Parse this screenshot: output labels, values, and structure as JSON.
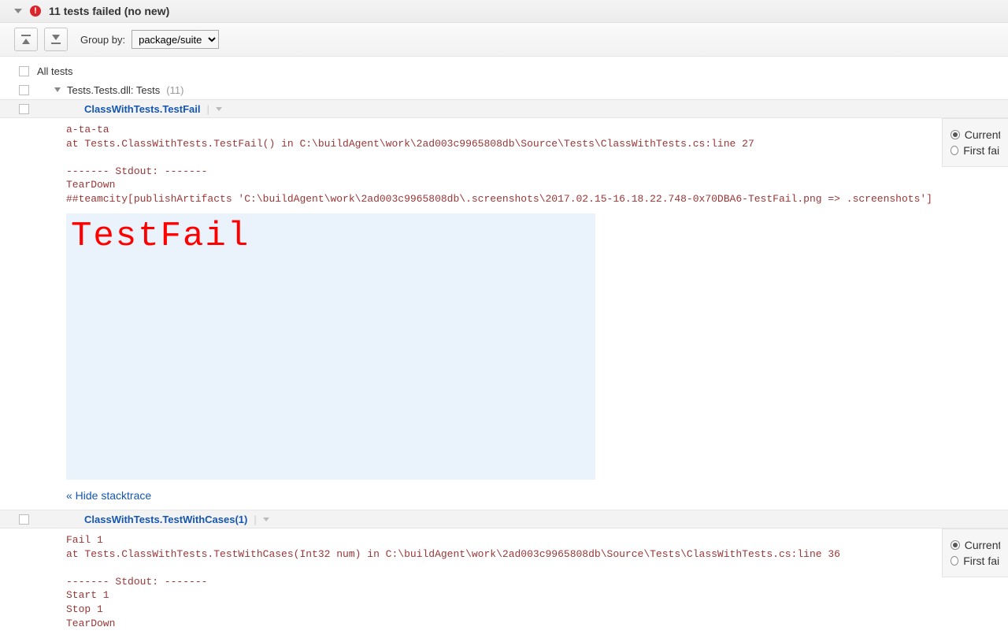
{
  "header": {
    "title": "11 tests failed (no new)"
  },
  "toolbar": {
    "group_by_label": "Group by:",
    "group_by_value": "package/suite"
  },
  "tree": {
    "all_tests_label": "All tests",
    "suite_label": "Tests.Tests.dll: Tests",
    "suite_count": "(11)"
  },
  "tests": [
    {
      "name": "ClassWithTests.TestFail",
      "stack": "a-ta-ta\nat Tests.ClassWithTests.TestFail() in C:\\buildAgent\\work\\2ad003c9965808db\\Source\\Tests\\ClassWithTests.cs:line 27\n\n------- Stdout: -------\nTearDown\n##teamcity[publishArtifacts 'C:\\buildAgent\\work\\2ad003c9965808db\\.screenshots\\2017.02.15-16.18.22.748-0x70DBA6-TestFail.png => .screenshots']",
      "screenshot_text": "TestFail",
      "hide_link": "« Hide stacktrace",
      "side": {
        "current": "Current",
        "first": "First failu"
      }
    },
    {
      "name": "ClassWithTests.TestWithCases(1)",
      "stack": "Fail 1\nat Tests.ClassWithTests.TestWithCases(Int32 num) in C:\\buildAgent\\work\\2ad003c9965808db\\Source\\Tests\\ClassWithTests.cs:line 36\n\n------- Stdout: -------\nStart 1\nStop 1\nTearDown",
      "side": {
        "current": "Current",
        "first": "First failu"
      }
    }
  ]
}
